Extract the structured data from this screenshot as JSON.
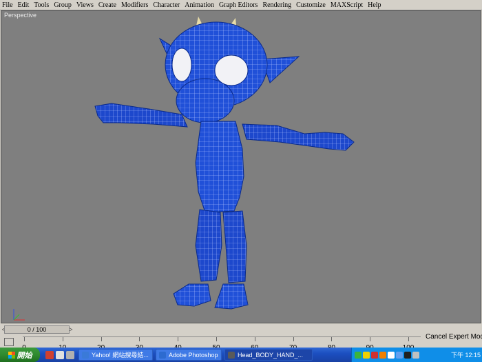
{
  "menu": [
    {
      "label": "File",
      "name": "menu-file"
    },
    {
      "label": "Edit",
      "name": "menu-edit"
    },
    {
      "label": "Tools",
      "name": "menu-tools"
    },
    {
      "label": "Group",
      "name": "menu-group"
    },
    {
      "label": "Views",
      "name": "menu-views"
    },
    {
      "label": "Create",
      "name": "menu-create"
    },
    {
      "label": "Modifiers",
      "name": "menu-modifiers"
    },
    {
      "label": "Character",
      "name": "menu-character"
    },
    {
      "label": "Animation",
      "name": "menu-animation"
    },
    {
      "label": "Graph Editors",
      "name": "menu-graph-editors"
    },
    {
      "label": "Rendering",
      "name": "menu-rendering"
    },
    {
      "label": "Customize",
      "name": "menu-customize"
    },
    {
      "label": "MAXScript",
      "name": "menu-maxscript"
    },
    {
      "label": "Help",
      "name": "menu-help"
    }
  ],
  "viewport": {
    "label": "Perspective",
    "model_color": "#1f4fd8",
    "background": "#7f7f7f"
  },
  "timeline": {
    "frame_display": "0 / 100",
    "prev": "<",
    "next": ">",
    "ticks": [
      "0",
      "10",
      "20",
      "30",
      "40",
      "50",
      "60",
      "70",
      "80",
      "90",
      "100"
    ],
    "status_text": "Cancel Expert Mode"
  },
  "taskbar": {
    "start_label": "開始",
    "tasks": [
      {
        "label": "Yahoo! 網站搜尋結...",
        "icon": "ie-icon",
        "color": "#3a7ad8"
      },
      {
        "label": "Adobe Photoshop",
        "icon": "photoshop-icon",
        "color": "#2d6bd0"
      },
      {
        "label": "Head_BODY_HAND_...",
        "icon": "3dsmax-icon",
        "color": "#5a5a5a"
      }
    ],
    "clock": "下午 12:15"
  }
}
